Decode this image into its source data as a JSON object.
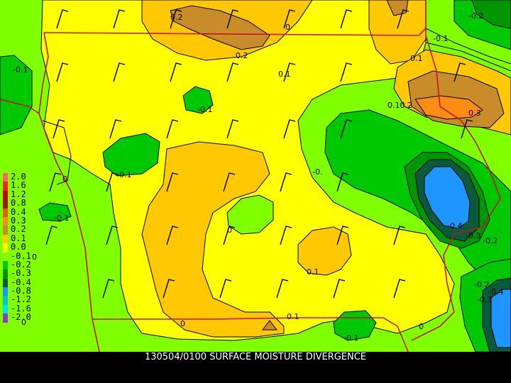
{
  "caption": "130504/0100 SURFACE MOISTURE DIVERGENCE",
  "colors": {
    "background": "#7fff00",
    "bottom_bar": "#000000",
    "state_border": "#c8141e",
    "contour": "#000000",
    "wind_barb": "#000000"
  },
  "legend": [
    {
      "label": "2.0",
      "color": "#ff6464"
    },
    {
      "label": "1.6",
      "color": "#ff1e1e"
    },
    {
      "label": "1.2",
      "color": "#c80000"
    },
    {
      "label": "0.8",
      "color": "#a01400"
    },
    {
      "label": "0.4",
      "color": "#e65a00"
    },
    {
      "label": "0.3",
      "color": "#ff8c14"
    },
    {
      "label": "0.2",
      "color": "#c88c28"
    },
    {
      "label": "0.1",
      "color": "#ffc800"
    },
    {
      "label": "0.0",
      "color": "#ffff00"
    },
    {
      "label": "-0.1",
      "color": "#7fff00"
    },
    {
      "label": "-0.2",
      "color": "#00c800"
    },
    {
      "label": "-0.3",
      "color": "#009600"
    },
    {
      "label": "-0.4",
      "color": "#0a5a3c"
    },
    {
      "label": "-0.8",
      "color": "#1e96ff"
    },
    {
      "label": "-1.2",
      "color": "#00c8c8"
    },
    {
      "label": "-1.6",
      "color": "#00e6e6"
    },
    {
      "label": "-2.0",
      "color": "#8c3cc8"
    }
  ],
  "contour_labels": [
    {
      "text": "-0.1"
    },
    {
      "text": "0"
    },
    {
      "text": "0.2"
    },
    {
      "text": "-0.2"
    },
    {
      "text": "-0.1"
    },
    {
      "text": "0.2"
    },
    {
      "text": "0.1"
    },
    {
      "text": "0.1"
    },
    {
      "text": "-0.1"
    },
    {
      "text": "0.10.2"
    },
    {
      "text": "0.3"
    },
    {
      "text": "0"
    },
    {
      "text": "-0.1"
    },
    {
      "text": "-0."
    },
    {
      "text": "-0.1"
    },
    {
      "text": "0"
    },
    {
      "text": "0"
    },
    {
      "text": "-0.4"
    },
    {
      "text": "-0.3"
    },
    {
      "text": "-0.2"
    },
    {
      "text": "0.1"
    },
    {
      "text": "-0.2"
    },
    {
      "text": "-0.4"
    },
    {
      "text": "-0.3"
    },
    {
      "text": "0.1"
    },
    {
      "text": "0"
    },
    {
      "text": "-0.1"
    },
    {
      "text": "0"
    },
    {
      "text": "0"
    }
  ]
}
